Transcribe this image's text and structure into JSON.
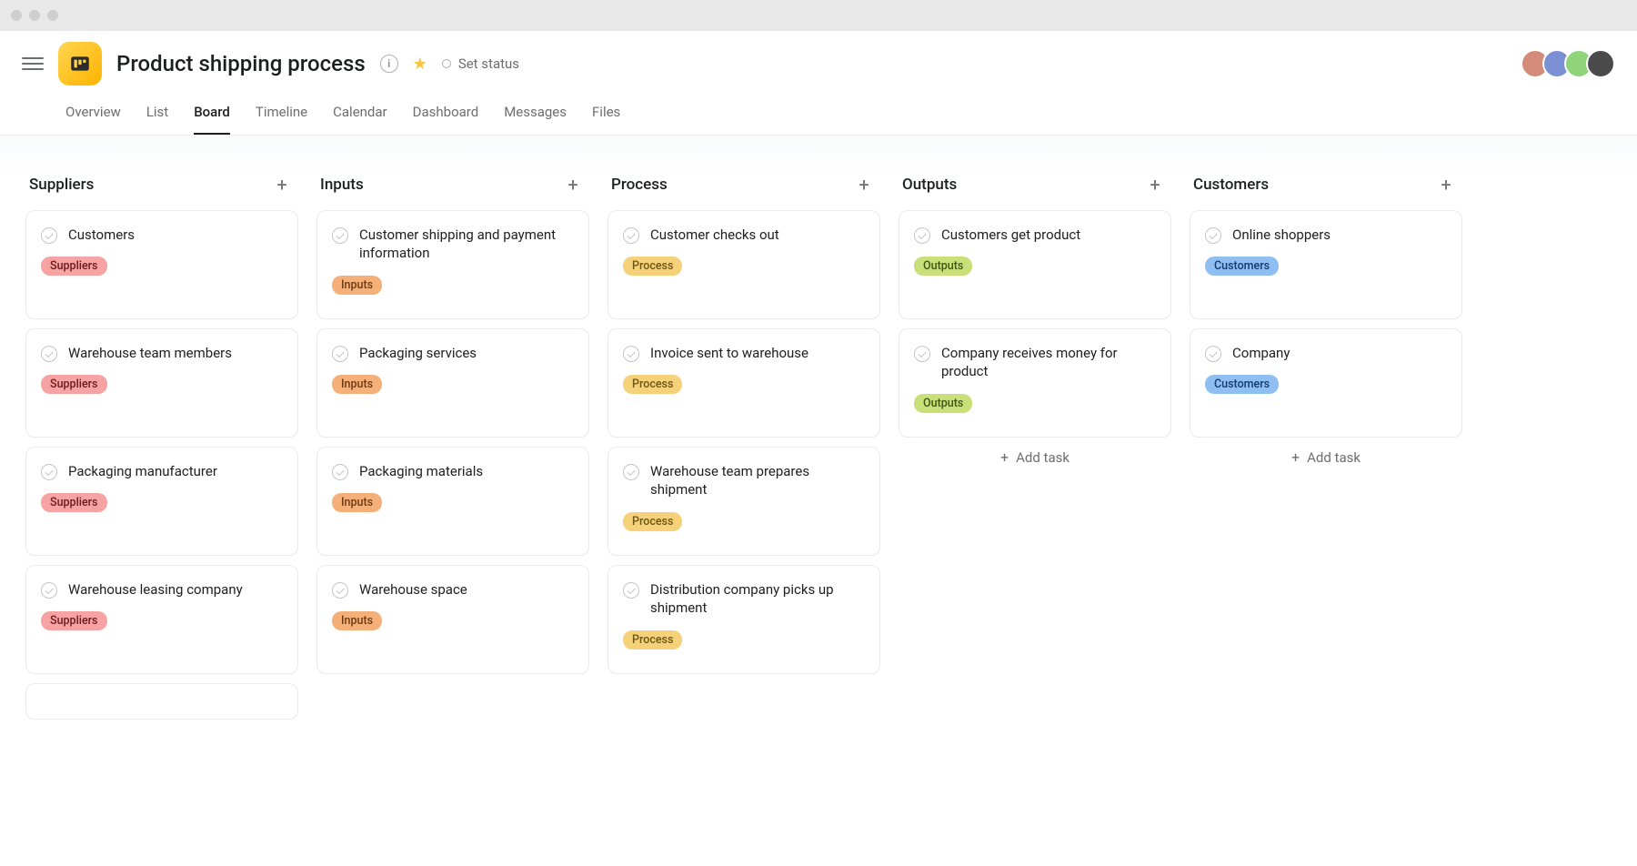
{
  "window": {
    "title": "Product shipping process"
  },
  "header": {
    "project_title": "Product shipping process",
    "status_label": "Set status"
  },
  "tabs": [
    {
      "label": "Overview",
      "active": false
    },
    {
      "label": "List",
      "active": false
    },
    {
      "label": "Board",
      "active": true
    },
    {
      "label": "Timeline",
      "active": false
    },
    {
      "label": "Calendar",
      "active": false
    },
    {
      "label": "Dashboard",
      "active": false
    },
    {
      "label": "Messages",
      "active": false
    },
    {
      "label": "Files",
      "active": false
    }
  ],
  "add_task_label": "Add task",
  "tag_labels": {
    "suppliers": "Suppliers",
    "inputs": "Inputs",
    "process": "Process",
    "outputs": "Outputs",
    "customers": "Customers"
  },
  "columns": [
    {
      "title": "Suppliers",
      "cards": [
        {
          "title": "Customers",
          "tag": "suppliers"
        },
        {
          "title": "Warehouse team members",
          "tag": "suppliers"
        },
        {
          "title": "Packaging manufacturer",
          "tag": "suppliers"
        },
        {
          "title": "Warehouse leasing company",
          "tag": "suppliers"
        }
      ],
      "has_more": true,
      "show_add_task": false
    },
    {
      "title": "Inputs",
      "cards": [
        {
          "title": "Customer shipping and payment information",
          "tag": "inputs"
        },
        {
          "title": "Packaging services",
          "tag": "inputs"
        },
        {
          "title": "Packaging materials",
          "tag": "inputs"
        },
        {
          "title": "Warehouse space",
          "tag": "inputs"
        }
      ],
      "has_more": false,
      "show_add_task": false
    },
    {
      "title": "Process",
      "cards": [
        {
          "title": "Customer checks out",
          "tag": "process"
        },
        {
          "title": "Invoice sent to warehouse",
          "tag": "process"
        },
        {
          "title": "Warehouse team prepares shipment",
          "tag": "process"
        },
        {
          "title": "Distribution company picks up shipment",
          "tag": "process"
        }
      ],
      "has_more": false,
      "show_add_task": false
    },
    {
      "title": "Outputs",
      "cards": [
        {
          "title": "Customers get product",
          "tag": "outputs"
        },
        {
          "title": "Company receives money for product",
          "tag": "outputs"
        }
      ],
      "has_more": false,
      "show_add_task": true
    },
    {
      "title": "Customers",
      "cards": [
        {
          "title": "Online shoppers",
          "tag": "customers"
        },
        {
          "title": "Company",
          "tag": "customers"
        }
      ],
      "has_more": false,
      "show_add_task": true
    }
  ]
}
